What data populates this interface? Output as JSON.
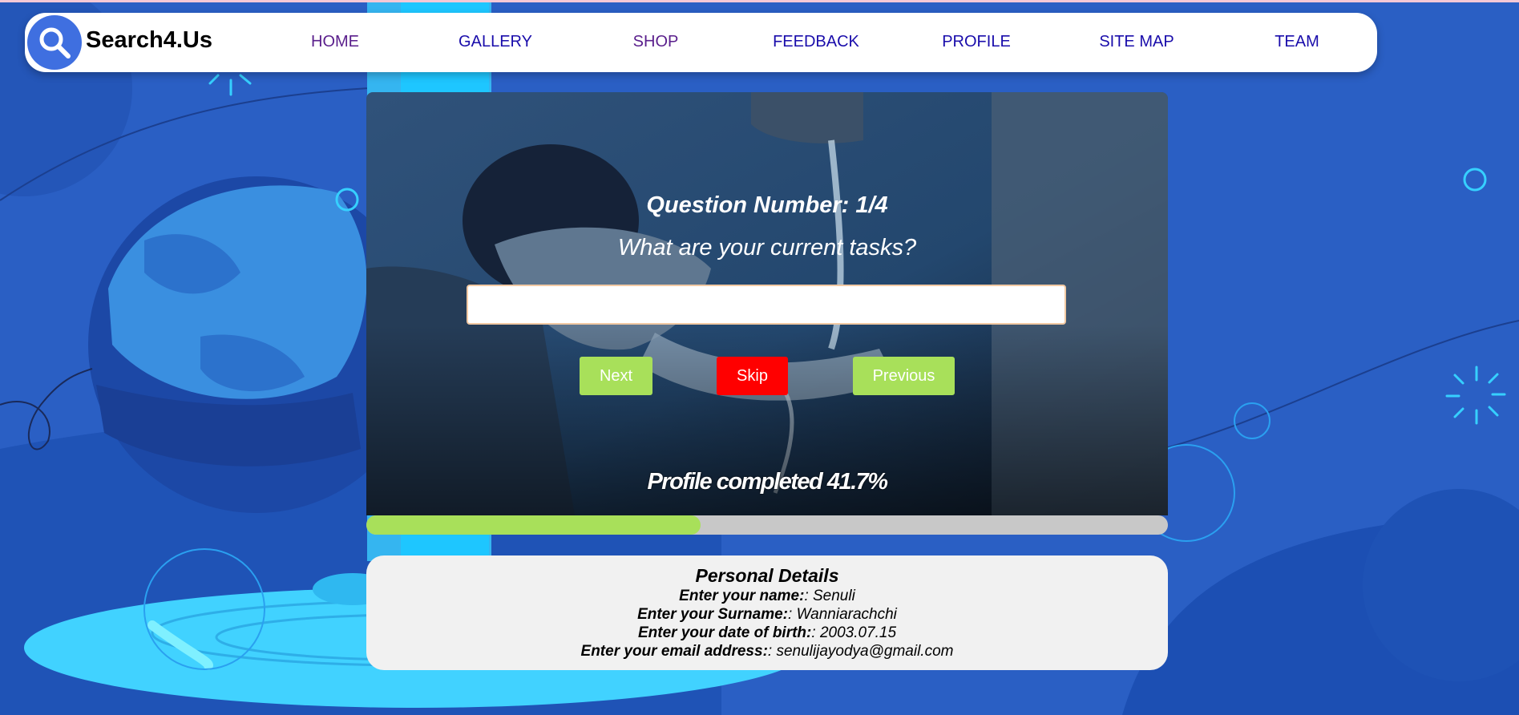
{
  "brand": {
    "name": "Search4.Us",
    "logo_icon": "search-icon"
  },
  "nav": {
    "items": [
      {
        "label": "HOME",
        "visited": true
      },
      {
        "label": "GALLERY",
        "visited": false
      },
      {
        "label": "SHOP",
        "visited": true
      },
      {
        "label": "FEEDBACK",
        "visited": false
      },
      {
        "label": "PROFILE",
        "visited": false
      },
      {
        "label": "SITE MAP",
        "visited": false
      },
      {
        "label": "TEAM",
        "visited": false
      }
    ]
  },
  "quiz": {
    "question_number": "Question Number: 1/4",
    "question_text": "What are your current tasks?",
    "answer_value": "",
    "buttons": {
      "next": "Next",
      "skip": "Skip",
      "previous": "Previous"
    },
    "progress_text": "Profile completed 41.7%",
    "progress_fraction": 0.417
  },
  "details": {
    "title": "Personal Details",
    "rows": [
      {
        "label": "Enter your name:",
        "sep": ": ",
        "value": "Senuli"
      },
      {
        "label": "Enter your Surname:",
        "sep": ": ",
        "value": "Wanniarachchi"
      },
      {
        "label": "Enter your date of birth:",
        "sep": ": ",
        "value": "2003.07.15"
      },
      {
        "label": "Enter your email address:",
        "sep": ": ",
        "value": "senulijayodya@gmail.com"
      }
    ]
  },
  "colors": {
    "background": "#2a5fc4",
    "accent_green": "#a8e05a",
    "skip_red": "#ff0000",
    "link": "#1a0dab",
    "link_visited": "#5a1f8c"
  }
}
